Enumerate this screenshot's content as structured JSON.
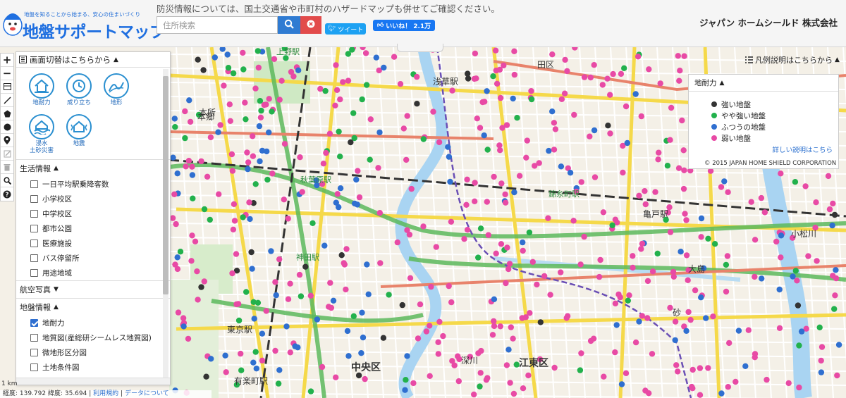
{
  "header": {
    "tagline": "地盤を知ることから始まる、安心の住まいづくり",
    "title": "地盤サポートマップ",
    "notice": "防災情報については、国土交通省や市町村のハザードマップも併せてご確認ください。",
    "search_placeholder": "住所検索",
    "tweet_label": "ツイート",
    "like_label": "いいね！",
    "like_count": "2.1万",
    "company": "ジャパン ホームシールド 株式会社"
  },
  "toolbar": {
    "tools": [
      "plus-icon",
      "minus-icon",
      "layers-icon",
      "line-icon",
      "polygon-icon",
      "circle-icon",
      "marker-icon",
      "edit-icon",
      "trash-icon",
      "search-icon",
      "help-icon"
    ]
  },
  "panel": {
    "header": "画面切替はこちらから",
    "modes": [
      {
        "label": "地耐力",
        "icon": "house-icon"
      },
      {
        "label": "成り立ち",
        "icon": "clock-icon"
      },
      {
        "label": "地形",
        "icon": "terrain-icon"
      },
      {
        "label": "浸水\n土砂災害",
        "icon": "flood-icon"
      },
      {
        "label": "地震",
        "icon": "earthquake-icon"
      }
    ],
    "life_title": "生活情報",
    "life_items": [
      "一日平均駅乗降客数",
      "小学校区",
      "中学校区",
      "都市公園",
      "医療施設",
      "バス停留所",
      "用途地域"
    ],
    "aerial_title": "航空写真",
    "ground_title": "地盤情報",
    "ground_items": [
      {
        "label": "地耐力",
        "checked": true
      },
      {
        "label": "地質図(産総研シームレス地質図)",
        "checked": false
      },
      {
        "label": "微地形区分図",
        "checked": false
      },
      {
        "label": "土地条件図",
        "checked": false
      }
    ]
  },
  "legend": {
    "toggle": "凡例説明はこちらから",
    "title": "地耐力",
    "items": [
      {
        "label": "強い地盤",
        "color": "#333333"
      },
      {
        "label": "やや強い地盤",
        "color": "#22b14c"
      },
      {
        "label": "ふつうの地盤",
        "color": "#2f6fd0"
      },
      {
        "label": "弱い地盤",
        "color": "#e84aa5"
      }
    ],
    "link": "詳しい説明はこちら",
    "copyright": "© 2015 JAPAN HOME SHIELD CORPORATION"
  },
  "map_labels": [
    {
      "text": "上野駅",
      "cls": "station"
    },
    {
      "text": "浅草駅",
      "cls": ""
    },
    {
      "text": "本所",
      "cls": ""
    },
    {
      "text": "秋葉原駅",
      "cls": "station"
    },
    {
      "text": "錦糸町駅",
      "cls": "station"
    },
    {
      "text": "亀戸駅",
      "cls": ""
    },
    {
      "text": "小松川",
      "cls": ""
    },
    {
      "text": "大島",
      "cls": ""
    },
    {
      "text": "神田駅",
      "cls": "station"
    },
    {
      "text": "東京駅",
      "cls": ""
    },
    {
      "text": "中央区",
      "cls": "big"
    },
    {
      "text": "江東区",
      "cls": "big"
    },
    {
      "text": "深川",
      "cls": ""
    },
    {
      "text": "砂",
      "cls": ""
    },
    {
      "text": "有楽町駅",
      "cls": ""
    },
    {
      "text": "本郷",
      "cls": ""
    },
    {
      "text": "田区",
      "cls": ""
    }
  ],
  "bottom": {
    "scale": "1 km",
    "coords": "経度: 139.792 緯度: 35.694",
    "terms": "利用規約",
    "data_about": "データについて"
  }
}
